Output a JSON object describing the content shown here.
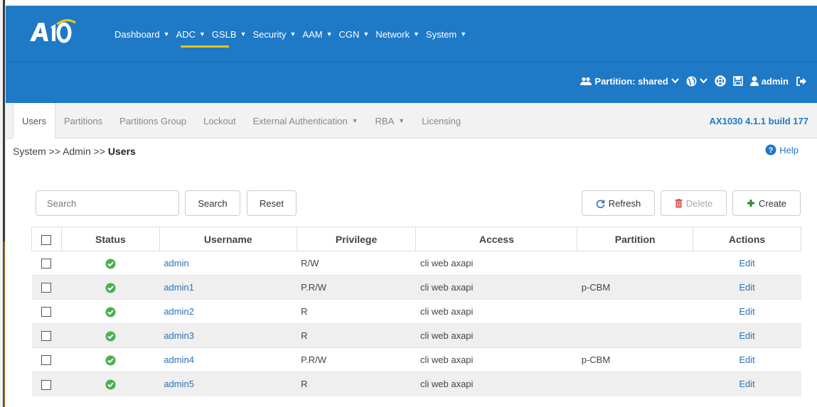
{
  "top_nav": {
    "logo_text": "A10",
    "items": [
      {
        "label": "Dashboard"
      },
      {
        "label": "ADC"
      },
      {
        "label": "GSLB"
      },
      {
        "label": "Security"
      },
      {
        "label": "AAM"
      },
      {
        "label": "CGN"
      },
      {
        "label": "Network"
      },
      {
        "label": "System"
      }
    ],
    "active_item": "ADC"
  },
  "user_bar": {
    "partition_label": "Partition: shared",
    "username": "admin",
    "icons": [
      "users-icon",
      "chevron-down-icon",
      "globe-icon",
      "chevron-down-icon",
      "lifebuoy-icon",
      "save-icon",
      "user-icon",
      "logout-icon"
    ]
  },
  "sub_tabs": {
    "items": [
      {
        "label": "Users",
        "has_caret": false
      },
      {
        "label": "Partitions",
        "has_caret": false
      },
      {
        "label": "Partitions Group",
        "has_caret": false
      },
      {
        "label": "Lockout",
        "has_caret": false
      },
      {
        "label": "External Authentication",
        "has_caret": true
      },
      {
        "label": "RBA",
        "has_caret": true
      },
      {
        "label": "Licensing",
        "has_caret": false
      }
    ],
    "active": "Users",
    "version": "AX1030 4.1.1 build 177"
  },
  "breadcrumb": {
    "part1": "System",
    "sep1": ">>",
    "part2": "Admin",
    "sep2": ">>",
    "current": "Users"
  },
  "help_label": "Help",
  "toolbar": {
    "search_placeholder": "Search",
    "search_button": "Search",
    "reset_button": "Reset",
    "refresh_button": "Refresh",
    "delete_button": "Delete",
    "create_button": "Create"
  },
  "table": {
    "columns": [
      "Status",
      "Username",
      "Privilege",
      "Access",
      "Partition",
      "Actions"
    ],
    "rows": [
      {
        "username": "admin",
        "privilege": "R/W",
        "access": "cli web axapi",
        "partition": "",
        "action": "Edit"
      },
      {
        "username": "admin1",
        "privilege": "P.R/W",
        "access": "cli web axapi",
        "partition": "p-CBM",
        "action": "Edit"
      },
      {
        "username": "admin2",
        "privilege": "R",
        "access": "cli web axapi",
        "partition": "",
        "action": "Edit"
      },
      {
        "username": "admin3",
        "privilege": "R",
        "access": "cli web axapi",
        "partition": "",
        "action": "Edit"
      },
      {
        "username": "admin4",
        "privilege": "P.R/W",
        "access": "cli web axapi",
        "partition": "p-CBM",
        "action": "Edit"
      },
      {
        "username": "admin5",
        "privilege": "R",
        "access": "cli web axapi",
        "partition": "",
        "action": "Edit"
      }
    ]
  },
  "colors": {
    "header_blue": "#1e79c6",
    "accent_yellow": "#f1c40f",
    "link_blue": "#2a72b8",
    "status_green": "#4caf50",
    "delete_red": "#d9534f",
    "create_green": "#2e8b2e"
  }
}
